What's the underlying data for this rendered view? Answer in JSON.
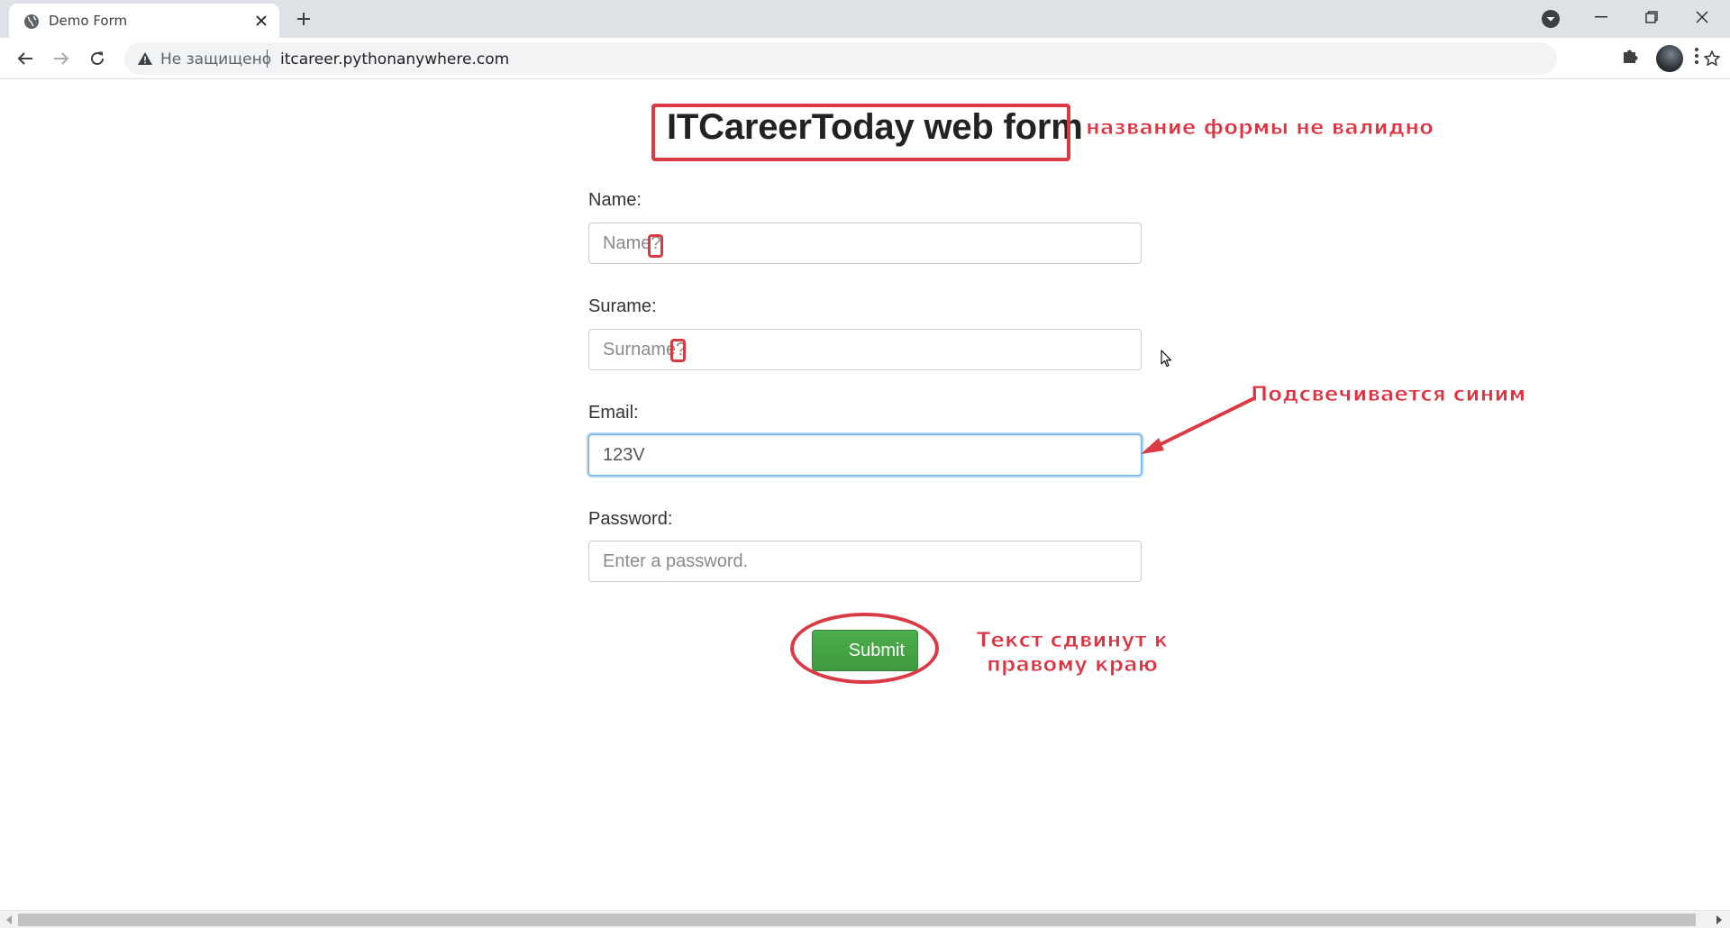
{
  "browser": {
    "tab_title": "Demo Form",
    "security_label": "Не защищено",
    "url": "itcareer.pythonanywhere.com"
  },
  "page": {
    "form_title": "ITCareerToday web form",
    "fields": [
      {
        "label": "Name:",
        "placeholder": "Name?",
        "value": ""
      },
      {
        "label": "Surame:",
        "placeholder": "Surname?",
        "value": ""
      },
      {
        "label": "Email:",
        "placeholder": "",
        "value": "123V"
      },
      {
        "label": "Password:",
        "placeholder": "Enter a password.",
        "value": ""
      }
    ],
    "submit_label": "Submit"
  },
  "annotations": {
    "title_note": "название формы не валидно",
    "email_note": "Подсвечивается синим",
    "submit_note": "Текст сдвинут к правому краю"
  },
  "colors": {
    "annotation": "#d93a43",
    "submit_green": "#449d44",
    "focus_blue": "#66afe9"
  },
  "icons": [
    "globe-icon",
    "close-icon",
    "plus-icon",
    "tab-search-icon",
    "minimize-icon",
    "restore-icon",
    "back-arrow-icon",
    "forward-arrow-icon",
    "reload-icon",
    "warning-icon",
    "share-icon",
    "star-icon",
    "puzzle-icon",
    "kebab-menu-icon",
    "mouse-cursor-icon"
  ]
}
